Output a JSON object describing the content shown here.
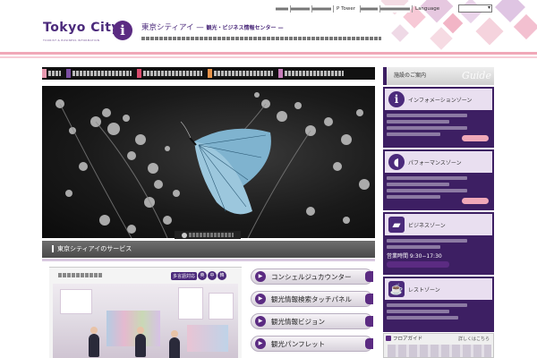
{
  "header": {
    "logo_text": "Tokyo City",
    "logo_sub": "TOURIST & BUSINESS INFORMATION",
    "logo_badge": "i",
    "site_title": "東京シティアイ —",
    "site_title_sub": "観光・ビジネス情報センター —",
    "top_nav": [
      "",
      "",
      "",
      "P Tower",
      "",
      ""
    ],
    "language_label": "Language",
    "language_select": ""
  },
  "sidebar": {
    "heading": "施設のご案内",
    "heading_script": "Guide",
    "cards": [
      {
        "title": "インフォメーションゾーン",
        "icon": "info-icon"
      },
      {
        "title": "パフォーマンスゾーン",
        "icon": "speech-bubble-icon"
      },
      {
        "title": "ビジネスゾーン",
        "icon": "briefcase-icon",
        "hours": "営業時間  9:30−17:30"
      },
      {
        "title": "レストゾーン",
        "icon": "coffee-cup-icon"
      }
    ],
    "floor_guide": {
      "title": "フロアガイド",
      "more": "詳しくはこちら"
    }
  },
  "services": {
    "heading": "東京シティアイのサービス",
    "concierge_title": "",
    "multilingual_label": "多言語対応",
    "languages": [
      "英",
      "中",
      "韓"
    ],
    "buttons": [
      "コンシェルジュカウンター",
      "観光情報検索タッチパネル",
      "観光情報ビジョン",
      "観光パンフレット"
    ]
  },
  "colors": {
    "brand_purple": "#4b2a7b",
    "dark_purple": "#3d1f63",
    "pink": "#f0a8b8"
  }
}
